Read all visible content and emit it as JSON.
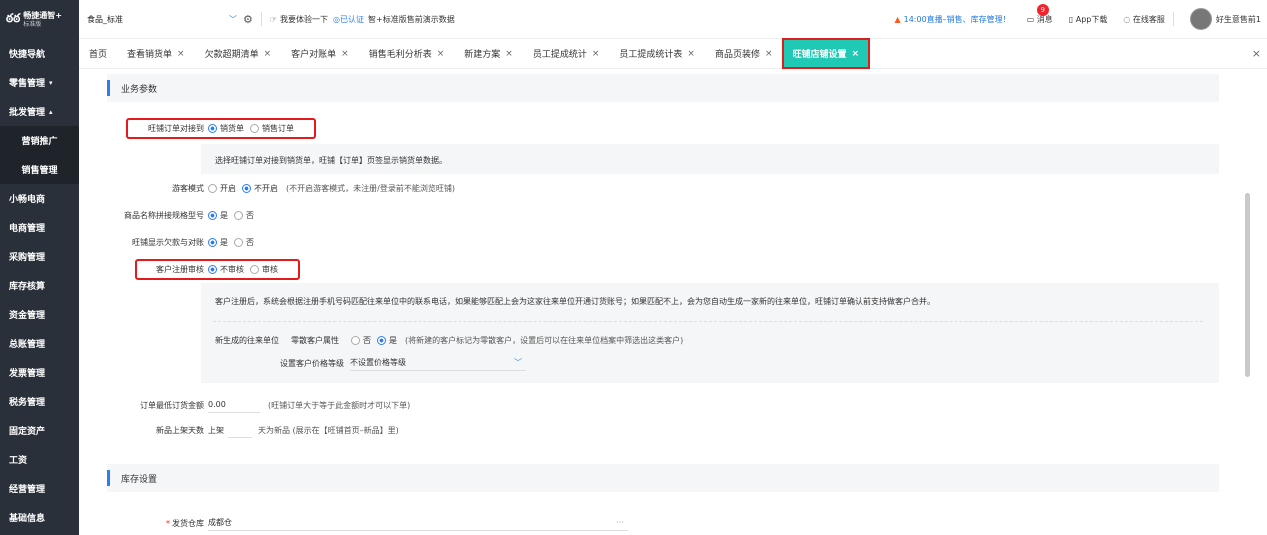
{
  "sidebar": {
    "logo_mark": "ఠఠ",
    "logo_name": "畅捷通智+",
    "logo_version": "标准版",
    "items": [
      {
        "label": "快捷导航"
      },
      {
        "label": "零售管理",
        "arrow": "▾"
      },
      {
        "label": "批发管理",
        "arrow": "▴"
      },
      {
        "label": "营销推广"
      },
      {
        "label": "销售管理"
      },
      {
        "label": "小畅电商"
      },
      {
        "label": "电商管理"
      },
      {
        "label": "采购管理"
      },
      {
        "label": "库存核算"
      },
      {
        "label": "资金管理"
      },
      {
        "label": "总账管理"
      },
      {
        "label": "发票管理"
      },
      {
        "label": "税务管理"
      },
      {
        "label": "固定资产"
      },
      {
        "label": "工资"
      },
      {
        "label": "经营管理"
      },
      {
        "label": "基础信息"
      }
    ]
  },
  "topbar": {
    "store": "食品_标准",
    "store_chevron": "﹀",
    "gear_icon": "⚙",
    "trial_icon": "☞",
    "trial": "我要体验一下",
    "cert": "已认证",
    "cert_icon": "◎",
    "demo": "智+标准版售前演示数据",
    "live_icon": "▲",
    "live": "14:00直播–销售、库存管理！",
    "msg_icon": "▭",
    "msg": "消息",
    "msg_count": "9",
    "app_icon": "▯",
    "app": "App下载",
    "service_icon": "◌",
    "service": "在线客服",
    "user": "好生意售前1"
  },
  "tabs": [
    {
      "label": "首页",
      "closable": false
    },
    {
      "label": "查看销货单",
      "closable": true
    },
    {
      "label": "欠款超期清单",
      "closable": true
    },
    {
      "label": "客户对账单",
      "closable": true
    },
    {
      "label": "销售毛利分析表",
      "closable": true
    },
    {
      "label": "新建方案",
      "closable": true
    },
    {
      "label": "员工提成统计",
      "closable": true
    },
    {
      "label": "员工提成统计表",
      "closable": true
    },
    {
      "label": "商品页装修",
      "closable": true
    },
    {
      "label": "旺铺店铺设置",
      "closable": true,
      "active": true
    }
  ],
  "tab_close_x": "×",
  "tab_close_all": "×",
  "business": {
    "title": "业务参数",
    "order_link": {
      "label": "旺铺订单对接到",
      "options": [
        "销货单",
        "销售订单"
      ],
      "selected": 0,
      "desc": "选择旺铺订单对接到销货单，旺铺【订单】页签显示销货单数据。"
    },
    "guest_mode": {
      "label": "游客模式",
      "options": [
        "开启",
        "不开启"
      ],
      "selected": 1,
      "note": "(不开启游客模式，未注册/登录前不能浏览旺铺)"
    },
    "name_spec": {
      "label": "商品名称拼接规格型号",
      "options": [
        "是",
        "否"
      ],
      "selected": 0
    },
    "show_debt": {
      "label": "旺铺显示欠款与对账",
      "options": [
        "是",
        "否"
      ],
      "selected": 0
    },
    "register_audit": {
      "label": "客户注册审核",
      "options": [
        "不审核",
        "审核"
      ],
      "selected": 0,
      "desc": "客户注册后，系统会根据注册手机号码匹配往来单位中的联系电话，如果能够匹配上会为这家往来单位开通订货账号；如果匹配不上，会为您自动生成一家新的往来单位，旺铺订单确认前支持做客户合并。",
      "new_unit_label": "新生成的往来单位",
      "retail_attr_label": "零散客户属性",
      "retail_options": [
        "否",
        "是"
      ],
      "retail_selected": 1,
      "retail_note": "(将新建的客户标记为零散客户，设置后可以在往来单位档案中筛选出这类客户)",
      "price_level_label": "设置客户价格等级",
      "price_level_value": "不设置价格等级",
      "price_level_chevron": "﹀"
    },
    "min_amount": {
      "label": "订单最低订货金额",
      "value": "0.00",
      "note": "(旺铺订单大于等于此金额时才可以下单)"
    },
    "new_days": {
      "label": "新品上架天数",
      "prefix": "上架",
      "value": "",
      "note": "天为新品 (展示在【旺铺首页–新品】里)"
    }
  },
  "inventory": {
    "title": "库存设置",
    "warehouse_required": "*",
    "warehouse_label": "发货仓库",
    "warehouse_value": "成都仓",
    "warehouse_more": "···"
  }
}
